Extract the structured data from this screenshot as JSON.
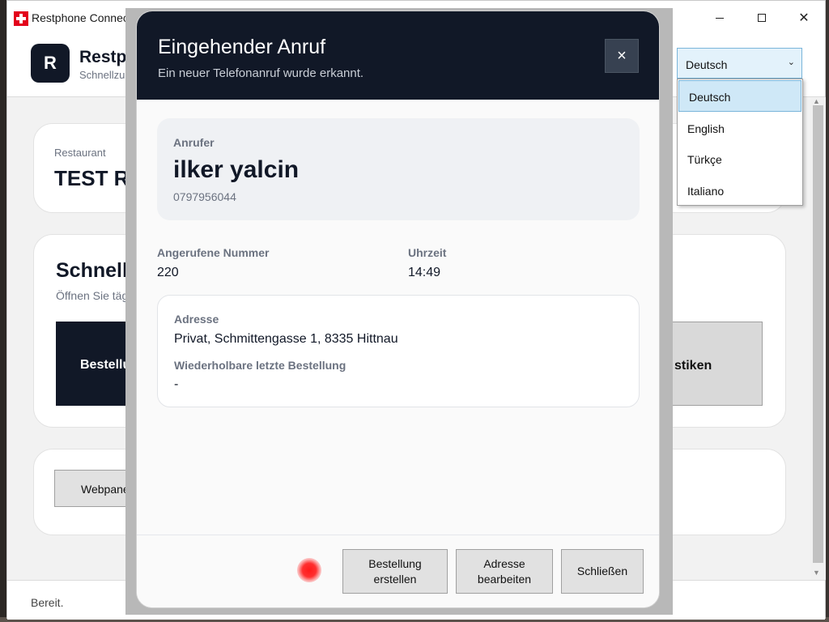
{
  "window": {
    "title": "Restphone Connecto",
    "app_name": "Restph",
    "app_subtitle": "Schnellzu",
    "logo_letter": "R"
  },
  "language": {
    "selected": "Deutsch",
    "options": [
      "Deutsch",
      "English",
      "Türkçe",
      "Italiano"
    ]
  },
  "restaurant": {
    "label": "Restaurant",
    "name": "TEST Re"
  },
  "quick_access": {
    "title": "Schnella",
    "subtitle": "Öffnen Sie täg",
    "tile_left": "Bestellu",
    "tile_right": "stiken"
  },
  "web_panel": {
    "button": "Webpane"
  },
  "status": {
    "text": "Bereit."
  },
  "modal": {
    "title": "Eingehender Anruf",
    "subtitle": "Ein neuer Telefonanruf wurde erkannt.",
    "close_glyph": "×",
    "caller_label": "Anrufer",
    "caller_name": "ilker yalcin",
    "caller_number": "0797956044",
    "called_number_label": "Angerufene Nummer",
    "called_number": "220",
    "time_label": "Uhrzeit",
    "time": "14:49",
    "address_label": "Adresse",
    "address": "Privat, Schmittengasse 1, 8335 Hittnau",
    "last_order_label": "Wiederholbare letzte Bestellung",
    "last_order": "-",
    "btn_create_order": "Bestellung erstellen",
    "btn_edit_address": "Adresse bearbeiten",
    "btn_close": "Schließen"
  },
  "colors": {
    "dark_navy": "#111827",
    "accent_blue": "#7ab5da",
    "recording_dot": "#ff1a1a"
  }
}
